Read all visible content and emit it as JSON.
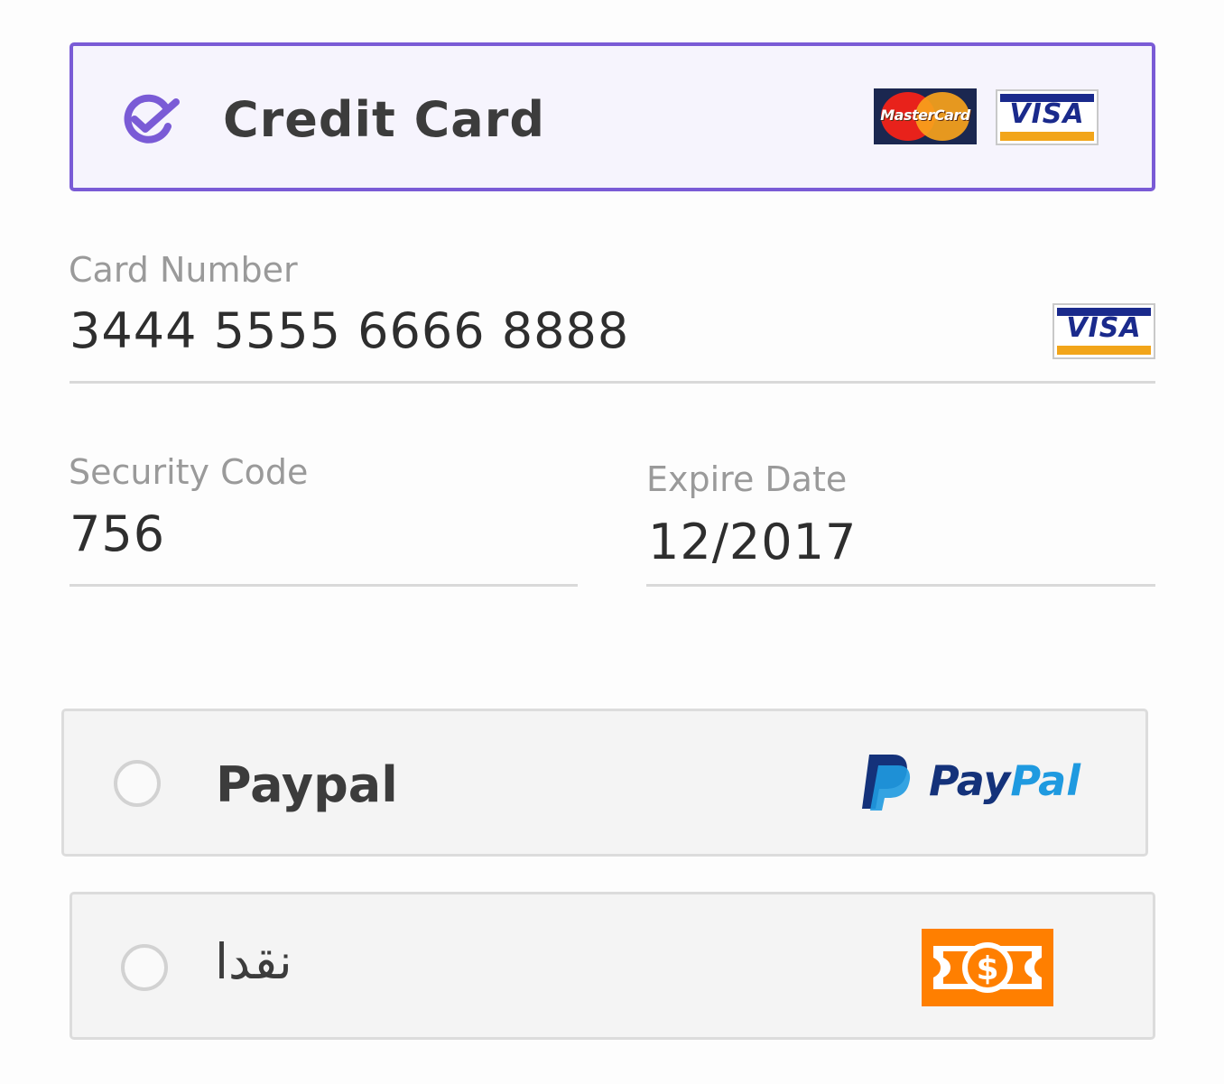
{
  "payment_options": {
    "credit_card": {
      "label": "Credit Card",
      "selected": true,
      "mastercard_logo_text": "MasterCard",
      "visa_logo_text": "VISA"
    },
    "paypal": {
      "label": "Paypal",
      "selected": false,
      "logo_text_pay": "Pay",
      "logo_text_pal": "Pal"
    },
    "cash": {
      "label": "نقدا",
      "selected": false,
      "icon": "dollar-bill-icon"
    }
  },
  "card_form": {
    "card_number": {
      "label": "Card Number",
      "value": "3444 5555 6666 8888",
      "brand_logo_text": "VISA"
    },
    "security_code": {
      "label": "Security Code",
      "value": "756"
    },
    "expire_date": {
      "label": "Expire Date",
      "value": "12/2017"
    }
  },
  "colors": {
    "accent": "#7a5bd6",
    "cash_icon": "#ff7f00",
    "paypal_dark": "#14327a",
    "paypal_light": "#1f9ae0"
  }
}
